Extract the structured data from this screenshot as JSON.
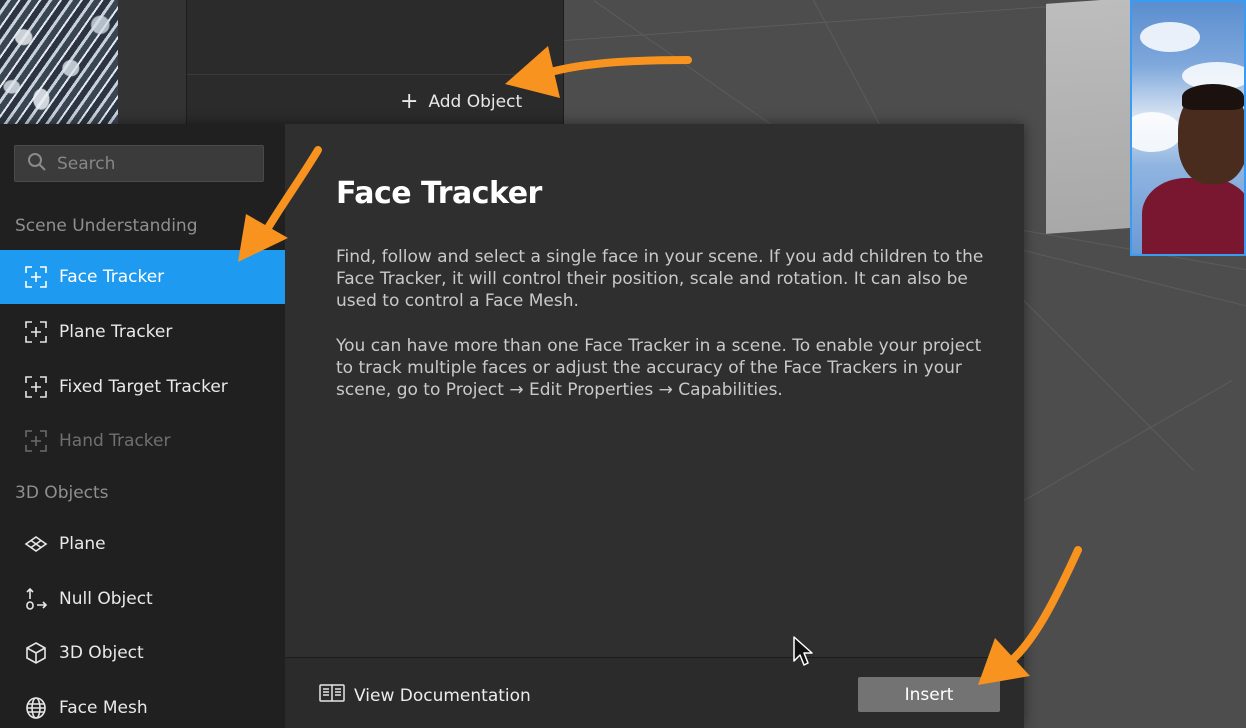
{
  "toolbar": {
    "add_object_label": "Add Object"
  },
  "search": {
    "placeholder": "Search"
  },
  "sidebar": {
    "sections": [
      {
        "label": "Scene Understanding",
        "items": [
          {
            "label": "Face Tracker",
            "icon": "tracker-icon",
            "state": "selected"
          },
          {
            "label": "Plane Tracker",
            "icon": "tracker-icon",
            "state": "normal"
          },
          {
            "label": "Fixed Target Tracker",
            "icon": "tracker-icon",
            "state": "normal"
          },
          {
            "label": "Hand Tracker",
            "icon": "tracker-icon",
            "state": "disabled"
          }
        ]
      },
      {
        "label": "3D Objects",
        "items": [
          {
            "label": "Plane",
            "icon": "plane-icon",
            "state": "normal"
          },
          {
            "label": "Null Object",
            "icon": "null-object-icon",
            "state": "normal"
          },
          {
            "label": "3D Object",
            "icon": "cube-icon",
            "state": "normal"
          },
          {
            "label": "Face Mesh",
            "icon": "face-mesh-icon",
            "state": "normal"
          }
        ]
      }
    ]
  },
  "detail": {
    "title": "Face Tracker",
    "paragraph1": "Find, follow and select a single face in your scene. If you add children to the Face Tracker, it will control their position, scale and rotation. It can also be used to control a Face Mesh.",
    "paragraph2": "You can have more than one Face Tracker in a scene. To enable your project to track multiple faces or adjust the accuracy of the Face Trackers in your scene, go to Project → Edit Properties → Capabilities."
  },
  "footer": {
    "doc_link_label": "View Documentation",
    "insert_label": "Insert"
  },
  "colors": {
    "accent": "#1e9bf0",
    "annotation_arrow": "#f7931e",
    "insert_button": "#737373"
  }
}
